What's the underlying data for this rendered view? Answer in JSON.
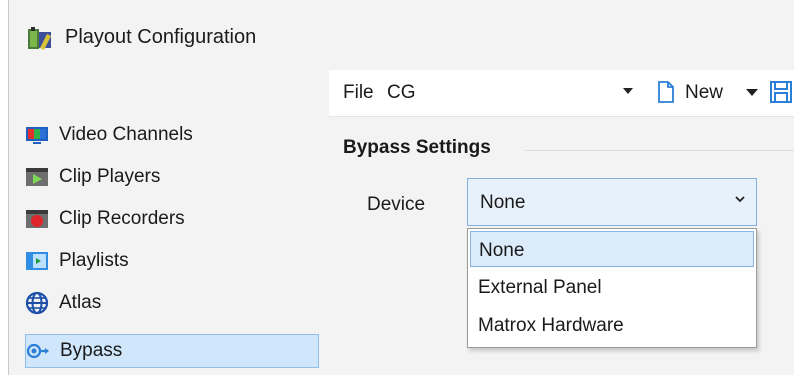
{
  "window": {
    "title": "Playout Configuration"
  },
  "sidebar": {
    "items": [
      {
        "label": "Video Channels",
        "icon": "video-channels-icon"
      },
      {
        "label": "Clip Players",
        "icon": "clip-players-icon"
      },
      {
        "label": "Clip Recorders",
        "icon": "clip-recorders-icon"
      },
      {
        "label": "Playlists",
        "icon": "playlists-icon"
      },
      {
        "label": "Atlas",
        "icon": "globe-icon"
      },
      {
        "label": "Bypass",
        "icon": "bypass-icon",
        "selected": true
      }
    ]
  },
  "toolbar": {
    "file_label": "File",
    "file_value": "CG",
    "new_label": "New"
  },
  "bypass": {
    "section_title": "Bypass Settings",
    "device_label": "Device",
    "device_value": "None",
    "options": [
      "None",
      "External Panel",
      "Matrox Hardware"
    ]
  },
  "colors": {
    "selection": "#cfe6fb",
    "accent": "#2b7fd6"
  }
}
